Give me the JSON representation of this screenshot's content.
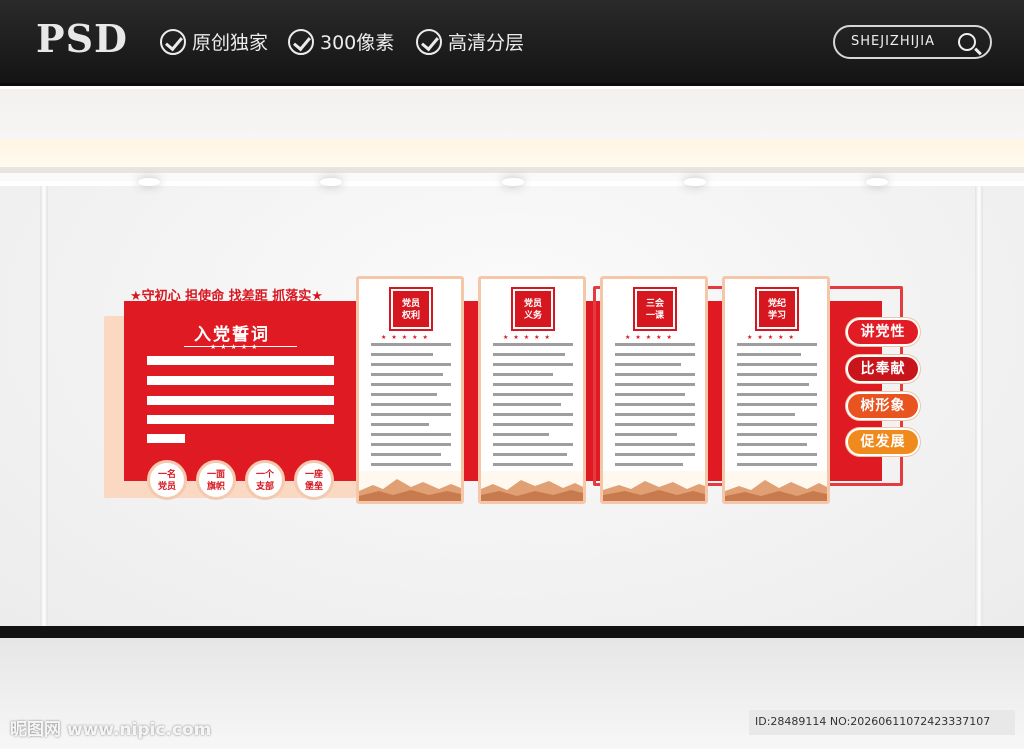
{
  "header": {
    "logo": "PSD",
    "features": [
      "原创独家",
      "300像素",
      "高清分层"
    ],
    "search_text": "SHEJIZHIJIA"
  },
  "display": {
    "slogan": "★守初心 担使命 找差距 抓落实★",
    "oath_title": "入党誓词",
    "circles": [
      "一名\n党员",
      "一面\n旗帜",
      "一个\n支部",
      "一座\n堡垒"
    ],
    "cards": [
      "党员\n权利",
      "党员\n义务",
      "三会\n一课",
      "党纪\n学习"
    ],
    "tags": [
      "讲党性",
      "比奉献",
      "树形象",
      "促发展"
    ]
  },
  "colors": {
    "primary_red": "#df1a22",
    "peach": "#fbd8c2",
    "orange": "#f08a1c"
  },
  "watermark": {
    "left": "昵图网 www.nipic.com",
    "right": "ID:28489114 NO:20260611072423337107"
  }
}
